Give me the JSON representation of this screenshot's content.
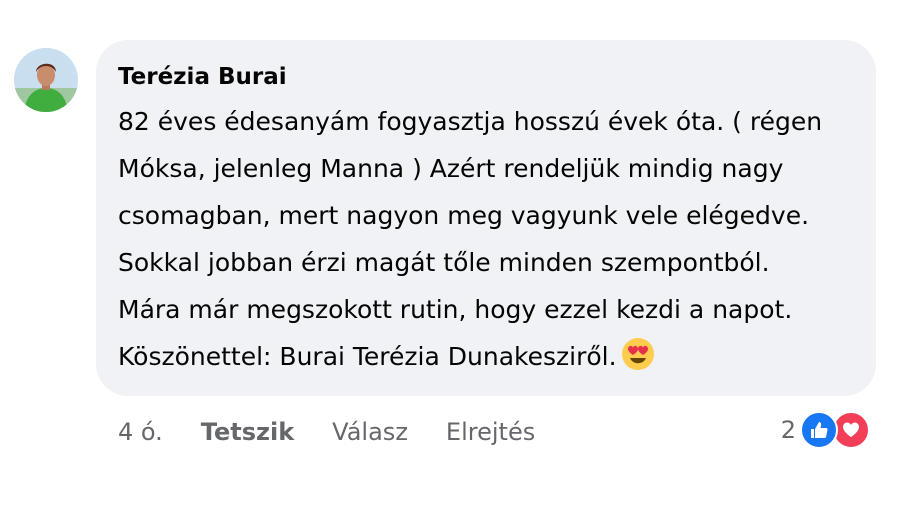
{
  "comment": {
    "author": "Terézia Burai",
    "text_lines": [
      "82 éves édesanyám fogyasztja hosszú évek óta. ( régen",
      "Móksa, jelenleg Manna ) Azért rendeljük mindig nagy",
      "csomagban, mert nagyon meg vagyunk vele elégedve.",
      "Sokkal jobban érzi magát tőle minden szempontból.",
      "Mára már megszokott rutin, hogy ezzel kezdi a napot.",
      "Köszönettel: Burai Terézia Dunakesziről."
    ],
    "emoji": "smiling-face-with-heart-eyes"
  },
  "actions": {
    "time": "4 ó.",
    "like_label": "Tetszik",
    "reply_label": "Válasz",
    "hide_label": "Elrejtés"
  },
  "reactions": {
    "count": "2",
    "icons": [
      "like-icon",
      "love-icon"
    ],
    "colors": {
      "like": "#1877f2",
      "love": "#f33e58"
    }
  },
  "colors": {
    "bubble_bg": "#f0f2f5",
    "text": "#050505",
    "secondary_text": "#65676b"
  }
}
